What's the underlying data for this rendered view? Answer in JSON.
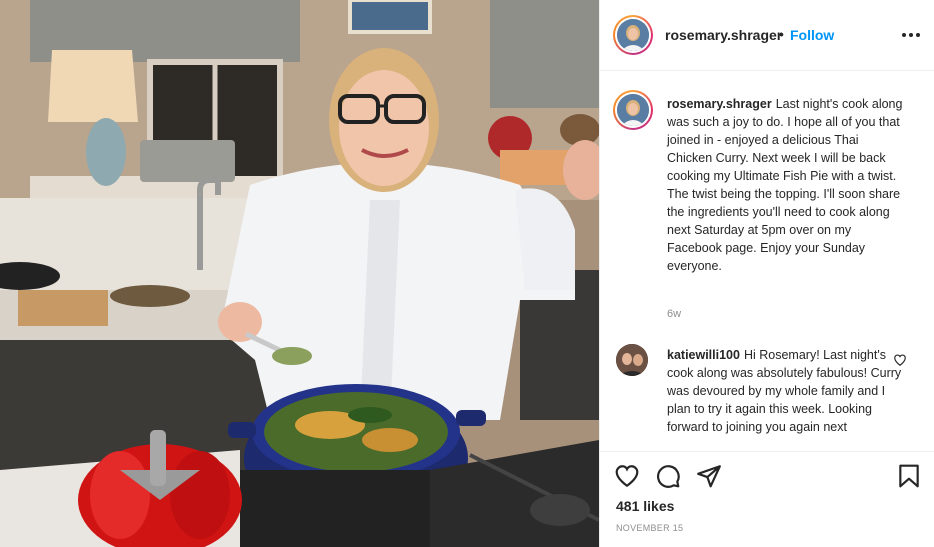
{
  "post": {
    "username": "rosemary.shrager",
    "separator": "•",
    "follow_label": "Follow",
    "more_icon": "more-horizontal-icon",
    "photo_alt": "Rosemary Shrager in a white chef jacket stirring a blue pan of Thai chicken curry in a kitchen"
  },
  "caption": {
    "username": "rosemary.shrager",
    "text": "Last night's cook along was such a joy to do. I hope all of you that joined in - enjoyed a delicious Thai Chicken Curry. Next week I will be back cooking my Ultimate Fish Pie with a twist. The twist being the topping. I'll soon share the ingredients you'll need to cook along next Saturday at 5pm over on my Facebook page. Enjoy your Sunday everyone.",
    "age": "6w"
  },
  "comments": [
    {
      "username": "katiewilli100",
      "text": "Hi Rosemary! Last night's cook along was absolutely fabulous! Curry was devoured by my whole family and I plan to try it again this week. Looking forward to joining you again next"
    }
  ],
  "actions": {
    "icons": [
      "heart-icon",
      "comment-icon",
      "share-icon",
      "bookmark-icon"
    ],
    "likes": "481 likes",
    "date": "NOVEMBER 15"
  },
  "colors": {
    "link": "#0095f6",
    "text": "#262626",
    "muted": "#8e8e8e",
    "border": "#efefef"
  }
}
